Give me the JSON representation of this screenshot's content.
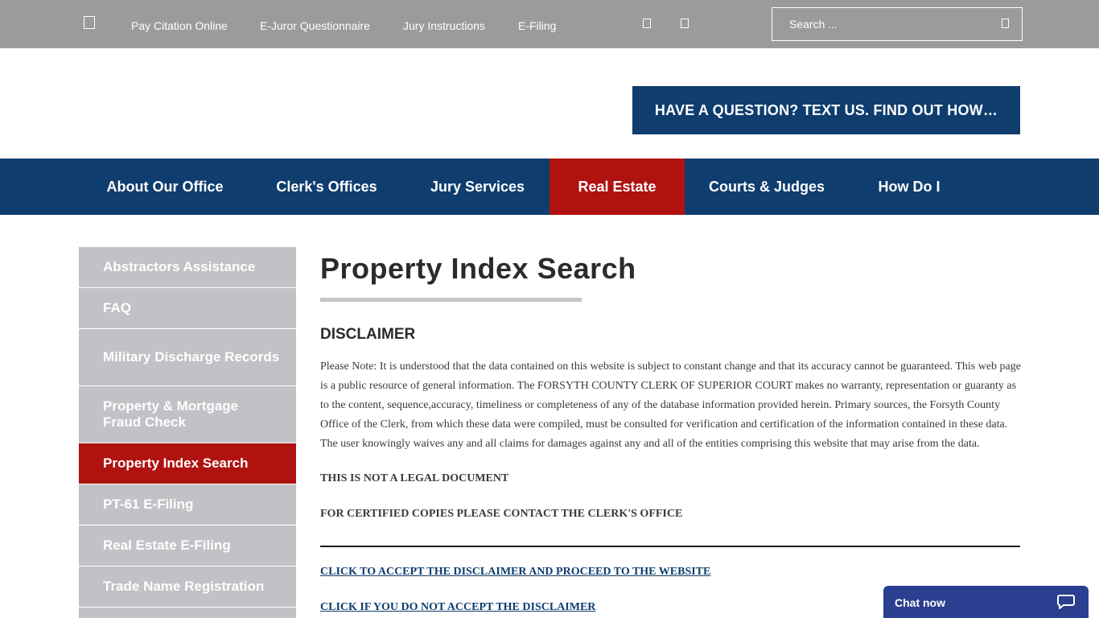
{
  "topbar": {
    "links": [
      "Pay Citation Online",
      "E-Juror Questionnaire",
      "Jury Instructions",
      "E-Filing"
    ],
    "search_placeholder": "Search ..."
  },
  "cta": {
    "label": "HAVE A QUESTION? TEXT US. FIND OUT HOW…"
  },
  "main_nav": {
    "items": [
      "About Our Office",
      "Clerk's Offices",
      "Jury Services",
      "Real Estate",
      "Courts & Judges",
      "How Do I"
    ],
    "active": "Real Estate"
  },
  "sidebar": {
    "items": [
      "Abstractors Assistance",
      "FAQ",
      "Military Discharge Records",
      "Property & Mortgage Fraud Check",
      "Property Index Search",
      "PT-61 E-Filing",
      "Real Estate E-Filing",
      "Trade Name Registration"
    ],
    "active": "Property Index Search"
  },
  "content": {
    "title": "Property Index Search",
    "disclaimer_heading": "DISCLAIMER",
    "disclaimer_text": "Please Note: It is understood that the data contained on this website is subject to constant change and that its accuracy cannot be guaranteed. This web page is a public resource of general information. The FORSYTH COUNTY CLERK OF SUPERIOR COURT makes no warranty, representation or guaranty as to the content, sequence,accuracy, timeliness or completeness of any of the database information provided herein. Primary sources, the Forsyth County Office of the Clerk, from which these data were compiled, must be consulted for verification and certification of the information contained in these data. The user knowingly waives any and all claims for damages against any and all of the entities comprising this website that may arise from the data.",
    "note_legal": "THIS IS NOT A LEGAL DOCUMENT",
    "note_certified": "FOR CERTIFIED COPIES PLEASE CONTACT THE CLERK'S OFFICE",
    "accept_link": "CLICK TO ACCEPT THE DISCLAIMER AND PROCEED TO THE WEBSITE",
    "decline_link": "CLICK IF YOU DO NOT ACCEPT THE DISCLAIMER"
  },
  "chat": {
    "label": "Chat now"
  },
  "colors": {
    "topbar": "#9b9b9b",
    "navy": "#0f3d6e",
    "active_red": "#b0120f",
    "sidebar_gray": "#c0c2c5",
    "chat_blue": "#2a3f8f"
  },
  "icons": {
    "home": "home-icon",
    "facebook": "facebook-icon",
    "twitter": "twitter-icon",
    "search": "search-icon",
    "chat": "chat-bubble-icon"
  }
}
